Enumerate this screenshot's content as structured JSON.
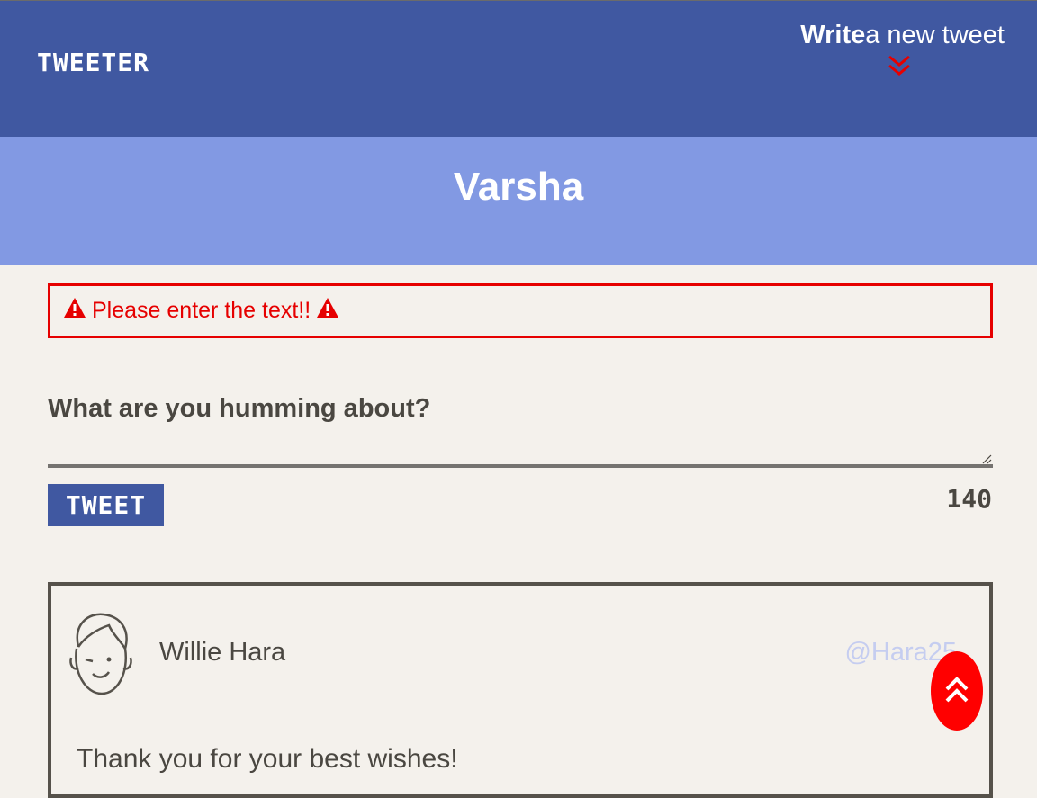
{
  "header": {
    "brand": "TWEETER",
    "compose_bold": "Write",
    "compose_rest": "a new tweet",
    "chevron_icon": "double-chevron-down-icon",
    "chevron_color": "#e60000",
    "bg_color": "#4058a1"
  },
  "banner": {
    "username": "Varsha",
    "bg_color": "#8299e3"
  },
  "alert": {
    "message": "Please enter the text!!",
    "icon": "warning-icon",
    "color": "#e60000"
  },
  "composer": {
    "placeholder": "What are you humming about?",
    "button_label": "TWEET",
    "char_count": "140"
  },
  "tweets": [
    {
      "avatar_icon": "person-avatar-icon",
      "name": "Willie Hara",
      "handle": "@Hara25",
      "text": "Thank you for your best wishes!"
    }
  ],
  "scroll_top": {
    "icon": "double-chevron-up-icon",
    "color": "#ff0000"
  }
}
